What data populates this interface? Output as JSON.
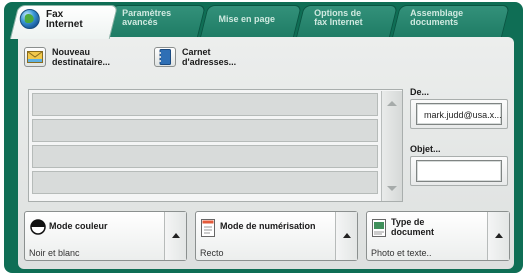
{
  "tabs": [
    {
      "label": "Fax\nInternet",
      "active": true
    },
    {
      "label": "Paramètres\navancés",
      "active": false
    },
    {
      "label": "Mise en page",
      "active": false
    },
    {
      "label": "Options de\nfax Internet",
      "active": false
    },
    {
      "label": "Assemblage\ndocuments",
      "active": false
    }
  ],
  "actions": {
    "new_recipient": "Nouveau\ndestinataire...",
    "address_book": "Carnet\nd'adresses..."
  },
  "from": {
    "label": "De...",
    "value": "mark.judd@usa.x..."
  },
  "subject": {
    "label": "Objet...",
    "value": ""
  },
  "options": [
    {
      "title": "Mode couleur",
      "value": "Noir et blanc",
      "icon": "color-mode-icon"
    },
    {
      "title": "Mode de numérisation",
      "value": "Recto",
      "icon": "scan-mode-icon"
    },
    {
      "title": "Type de\ndocument",
      "value": "Photo et texte..",
      "icon": "document-type-icon"
    }
  ],
  "colors": {
    "frame": "#0f6e55",
    "panel": "#e4e7e6"
  }
}
